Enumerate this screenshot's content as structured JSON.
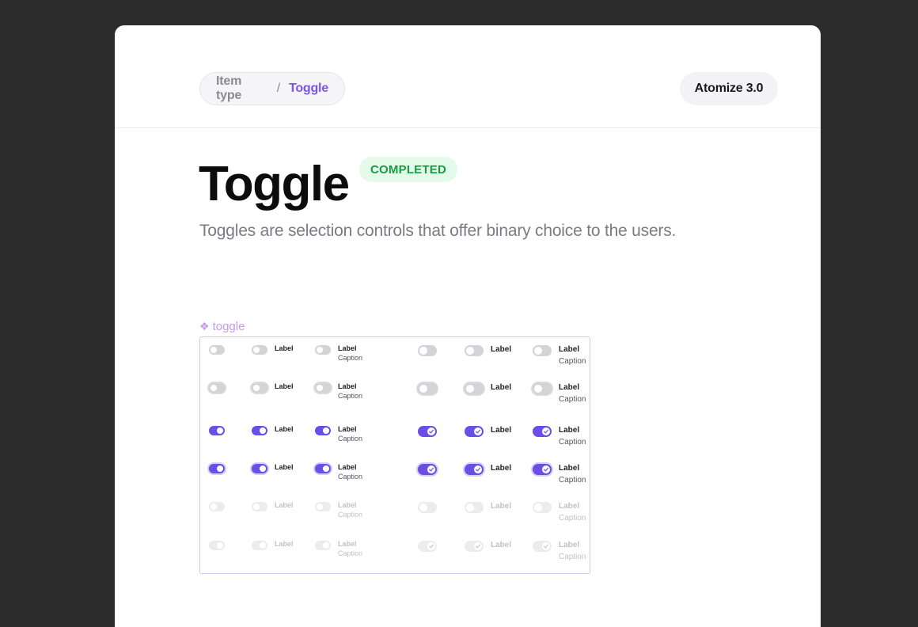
{
  "breadcrumb": {
    "parent": "Item type",
    "separator": "/",
    "current": "Toggle"
  },
  "version_label": "Atomize 3.0",
  "title": "Toggle",
  "status_badge": "COMPLETED",
  "subtitle": "Toggles are selection controls that offer binary choice to the users.",
  "component_tag": "toggle",
  "toggle_text": {
    "label": "Label",
    "caption": "Caption"
  },
  "colors": {
    "accent": "#6b4ee6",
    "off_track": "#d3d3d8",
    "disabled_track": "#ececef",
    "completed_badge_text": "#1a9a45",
    "completed_badge_bg": "#e4fbea"
  },
  "icons": {
    "component": "component-icon",
    "check": "check-icon"
  },
  "grid": {
    "column_variants": [
      "plain",
      "label",
      "label-caption",
      "plain-check",
      "label-check",
      "label-caption-check"
    ],
    "row_states": [
      "off",
      "off-focused",
      "on",
      "on-focused",
      "disabled-off",
      "disabled-on"
    ]
  }
}
